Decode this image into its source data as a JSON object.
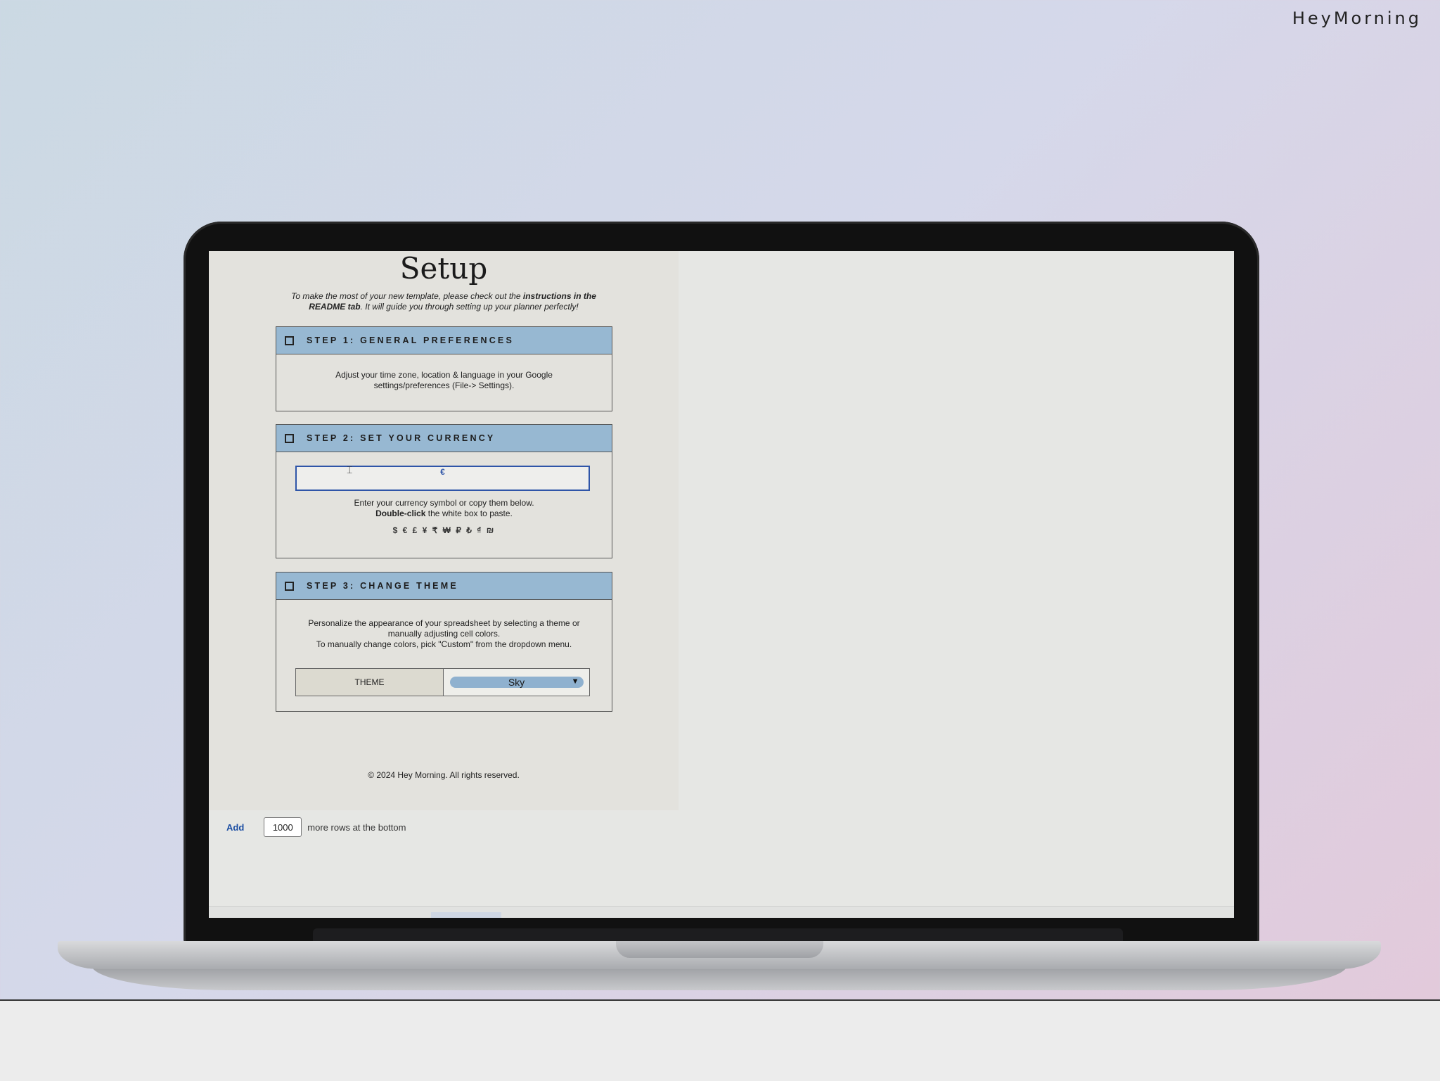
{
  "brand": "HeyMorning",
  "setup": {
    "title": "Setup",
    "intro_1": "To make the most of your new template, please check out the ",
    "intro_bold_1": "instructions in the README tab",
    "intro_2": ". It will guide you through setting up your planner perfectly!"
  },
  "step1": {
    "title": "STEP 1: GENERAL PREFERENCES",
    "text_1": "Adjust your time zone, location & language in your Google",
    "text_2": "settings/preferences (File-> Settings)."
  },
  "step2": {
    "title": "STEP 2: SET YOUR CURRENCY",
    "currency_value": "€",
    "text_1": "Enter your currency symbol or copy them below.",
    "text_bold": "Double-click",
    "text_2": " the white box to paste.",
    "symbols": "$ € £ ¥ ₹ ₩ ₽ ₺ ₫ ₪"
  },
  "step3": {
    "title": "STEP 3: CHANGE THEME",
    "text_1": "Personalize the appearance of your spreadsheet by selecting a theme or",
    "text_2": "manually adjusting cell colors.",
    "text_3": "To manually change colors, pick \"Custom\" from the dropdown menu.",
    "theme_label": "THEME",
    "theme_value": "Sky"
  },
  "copyright": "© 2024 Hey Morning. All rights reserved.",
  "add_rows": {
    "link": "Add",
    "value": "1000",
    "suffix": "more rows at the bottom"
  },
  "colors": {
    "header_blue": "#97b8d2",
    "select_blue": "#8fb1cf",
    "focus_blue": "#2f55a8",
    "sheet_bg": "#e3e2dd"
  }
}
